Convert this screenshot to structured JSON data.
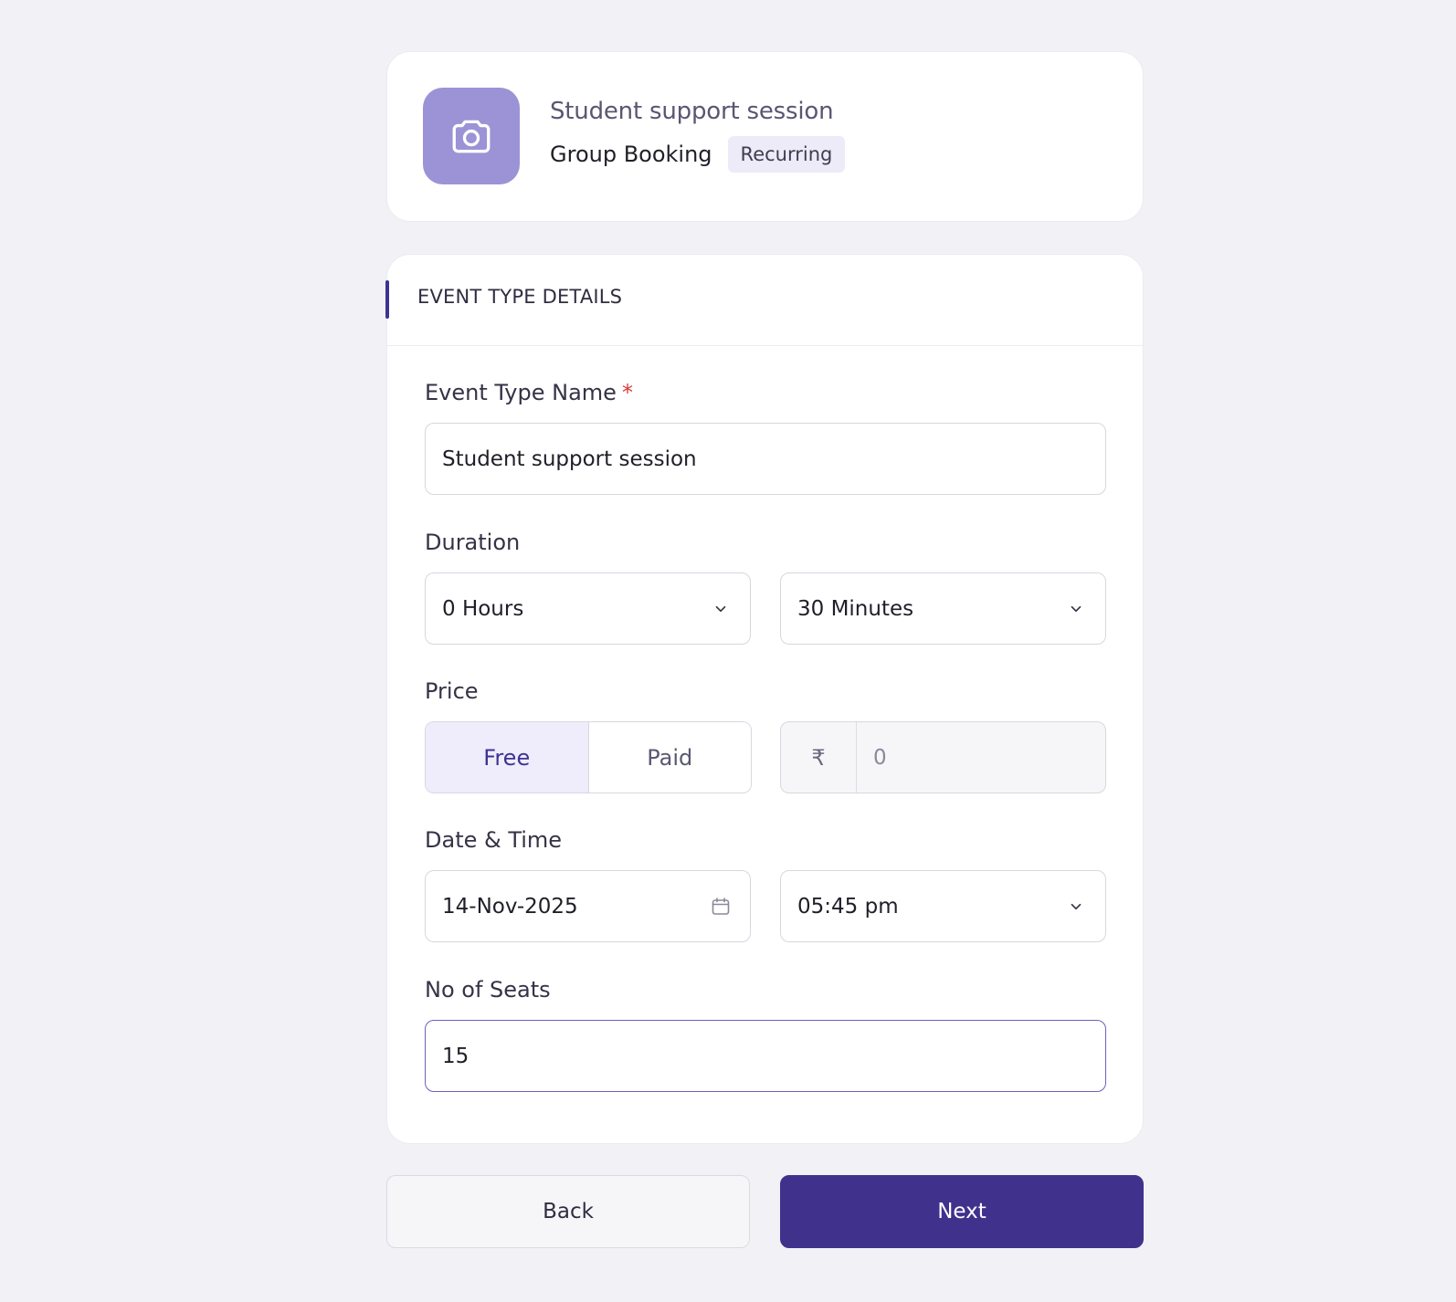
{
  "summary": {
    "avatar_icon": "camera-icon",
    "title": "Student support session",
    "booking_type": "Group Booking",
    "badge": "Recurring"
  },
  "section": {
    "title": "EVENT TYPE DETAILS"
  },
  "fields": {
    "event_type_name": {
      "label": "Event Type Name",
      "required_mark": "*",
      "value": "Student support session"
    },
    "duration": {
      "label": "Duration",
      "hours": "0 Hours",
      "minutes": "30 Minutes"
    },
    "price": {
      "label": "Price",
      "options": [
        "Free",
        "Paid"
      ],
      "selected": "Free",
      "currency_symbol": "₹",
      "amount": "0"
    },
    "date_time": {
      "label": "Date & Time",
      "date": "14-Nov-2025",
      "time": "05:45 pm"
    },
    "seats": {
      "label": "No of Seats",
      "value": "15"
    }
  },
  "actions": {
    "back_label": "Back",
    "next_label": "Next"
  },
  "colors": {
    "accent": "#40318d",
    "avatar_bg": "#9b93d6",
    "page_bg": "#f1f1f6",
    "required": "#d93a3a"
  }
}
